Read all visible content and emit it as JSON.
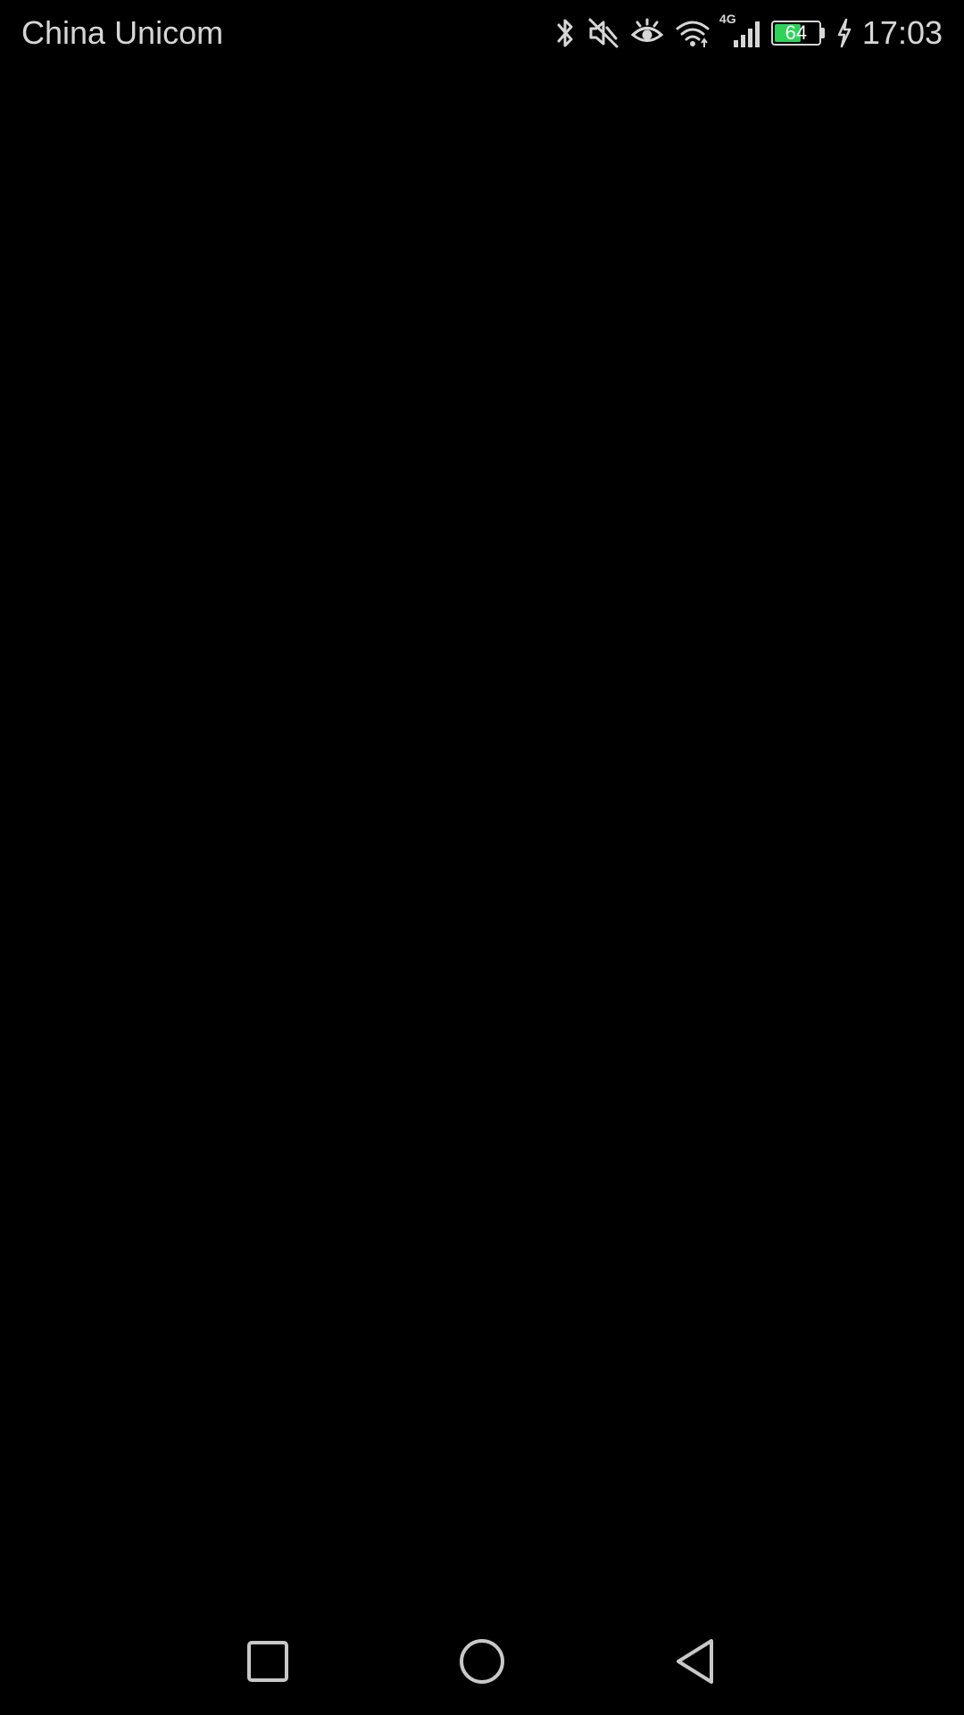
{
  "status_bar": {
    "carrier": "China Unicom",
    "network_type": "4G",
    "battery_level": "64",
    "battery_fraction": 0.64,
    "time": "17:03",
    "icons": [
      "bluetooth-icon",
      "mute-icon",
      "eye-comfort-icon",
      "wifi-icon",
      "signal-icon",
      "battery-icon",
      "charging-icon"
    ]
  },
  "colors": {
    "background": "#000000",
    "status_text": "#d6d6d6",
    "battery_fill": "#2fd35a"
  },
  "nav_bar": {
    "buttons": [
      "recent-apps",
      "home",
      "back"
    ]
  }
}
